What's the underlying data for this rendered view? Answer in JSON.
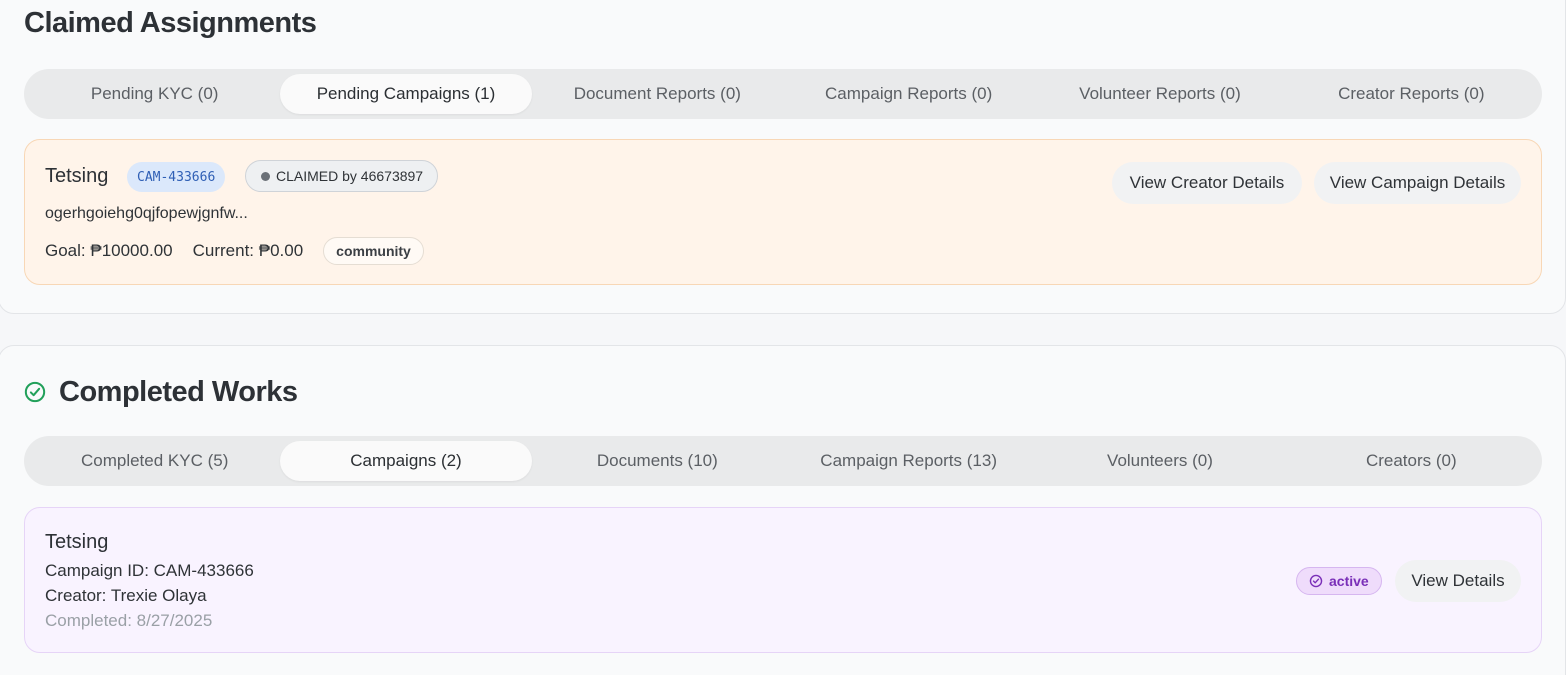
{
  "claimed": {
    "title": "Claimed Assignments",
    "tabs": [
      {
        "label": "Pending KYC (0)"
      },
      {
        "label": "Pending Campaigns (1)"
      },
      {
        "label": "Document Reports (0)"
      },
      {
        "label": "Campaign Reports (0)"
      },
      {
        "label": "Volunteer Reports (0)"
      },
      {
        "label": "Creator Reports (0)"
      }
    ],
    "active_tab": "Pending Campaigns (1)",
    "card": {
      "title": "Tetsing",
      "campaign_id": "CAM-433666",
      "claimed_label": "CLAIMED by 46673897",
      "description": "ogerhgoiehg0qjfopewjgnfw...",
      "goal": "Goal: ₱10000.00",
      "current": "Current: ₱0.00",
      "category": "community",
      "view_creator_label": "View Creator Details",
      "view_campaign_label": "View Campaign Details"
    }
  },
  "completed": {
    "title": "Completed Works",
    "icon": "check-circle-icon",
    "tabs": [
      {
        "label": "Completed KYC (5)"
      },
      {
        "label": "Campaigns (2)"
      },
      {
        "label": "Documents (10)"
      },
      {
        "label": "Campaign Reports (13)"
      },
      {
        "label": "Volunteers (0)"
      },
      {
        "label": "Creators (0)"
      }
    ],
    "active_tab": "Campaigns (2)",
    "card": {
      "title": "Tetsing",
      "campaign_id_line": "Campaign ID: CAM-433666",
      "creator_line": "Creator: Trexie Olaya",
      "completed_line": "Completed: 8/27/2025",
      "status": "active",
      "view_details_label": "View Details"
    }
  },
  "colors": {
    "claimed_card_bg": "#fff4ea",
    "claimed_card_border": "#f8d7b6",
    "completed_card_bg": "#f9f3ff",
    "completed_card_border": "#e6d4f7",
    "id_chip_bg": "#dbe8fb",
    "id_chip_text": "#2f5fb5",
    "status_chip_bg": "#efdcfb",
    "status_chip_text": "#7a2fb8",
    "success_icon": "#22a05a"
  }
}
